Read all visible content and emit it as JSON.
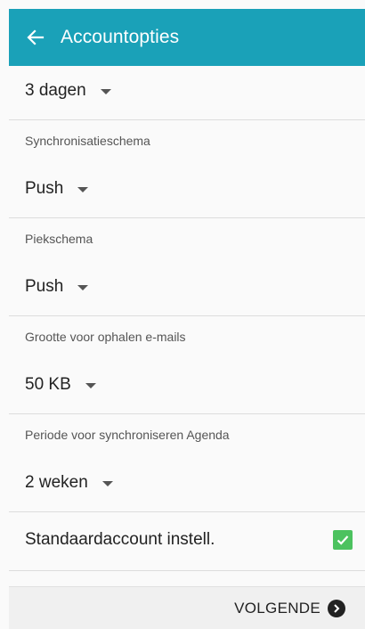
{
  "header": {
    "back_icon": "arrow-left-icon",
    "title": "Accountopties",
    "bg_color": "#1aa1b8"
  },
  "settings": {
    "sync_period": {
      "value": "3 dagen"
    },
    "sync_schedule": {
      "label": "Synchronisatieschema",
      "value": "Push"
    },
    "peak_schedule": {
      "label": "Piekschema",
      "value": "Push"
    },
    "retrieval_size": {
      "label": "Grootte voor ophalen e-mails",
      "value": "50 KB"
    },
    "calendar_sync": {
      "label": "Periode voor synchroniseren Agenda",
      "value": "2 weken"
    },
    "default_account": {
      "label": "Standaardaccount instell.",
      "checked": true,
      "check_color": "#4cc25f"
    }
  },
  "footer": {
    "next_label": "VOLGENDE",
    "next_icon": "chevron-right-circle-icon"
  }
}
